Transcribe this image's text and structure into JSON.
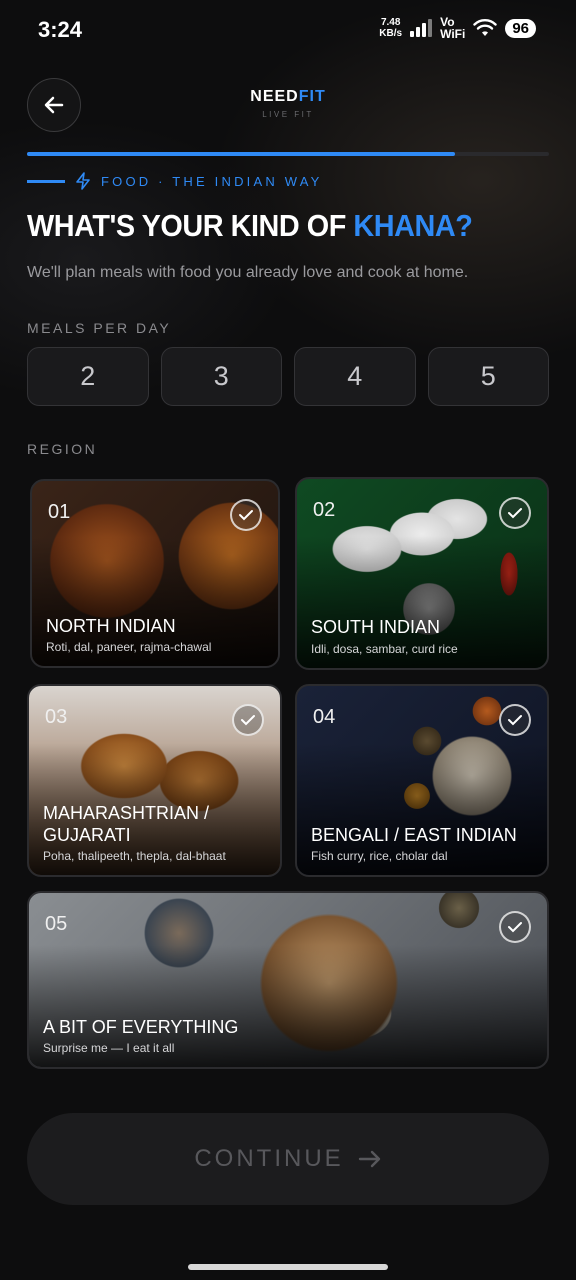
{
  "status_bar": {
    "time": "3:24",
    "net_speed_value": "7.48",
    "net_speed_unit": "KB/s",
    "vo_label": "Vo",
    "wifi_label": "WiFi",
    "battery": "96"
  },
  "header": {
    "brand_need": "NEED",
    "brand_fit": "FIT",
    "tagline": "LIVE FIT",
    "back_icon": "arrow-left-icon"
  },
  "progress": {
    "fraction": 0.82
  },
  "section_tag": {
    "icon": "lightning-icon",
    "text": "FOOD · THE INDIAN WAY"
  },
  "title": {
    "prefix": "WHAT'S YOUR KIND OF ",
    "accent": "KHANA?"
  },
  "subtitle": "We'll plan meals with food you already love and cook at home.",
  "meals_per_day": {
    "label": "MEALS PER DAY",
    "options": [
      "2",
      "3",
      "4",
      "5"
    ]
  },
  "region": {
    "label": "REGION",
    "cards": [
      {
        "num": "01",
        "name": "NORTH INDIAN",
        "desc": "Roti, dal, paneer, rajma-chawal"
      },
      {
        "num": "02",
        "name": "SOUTH INDIAN",
        "desc": "Idli, dosa, sambar, curd rice"
      },
      {
        "num": "03",
        "name": "MAHARASHTRIAN / GUJARATI",
        "desc": "Poha, thalipeeth, thepla, dal-bhaat"
      },
      {
        "num": "04",
        "name": "BENGALI / EAST INDIAN",
        "desc": "Fish curry, rice, cholar dal"
      },
      {
        "num": "05",
        "name": "A BIT OF EVERYTHING",
        "desc": "Surprise me — I eat it all"
      }
    ]
  },
  "continue": {
    "label": "CONTINUE",
    "icon": "arrow-right-icon"
  },
  "colors": {
    "accent": "#2f8af5",
    "background": "#0d0d0e"
  }
}
